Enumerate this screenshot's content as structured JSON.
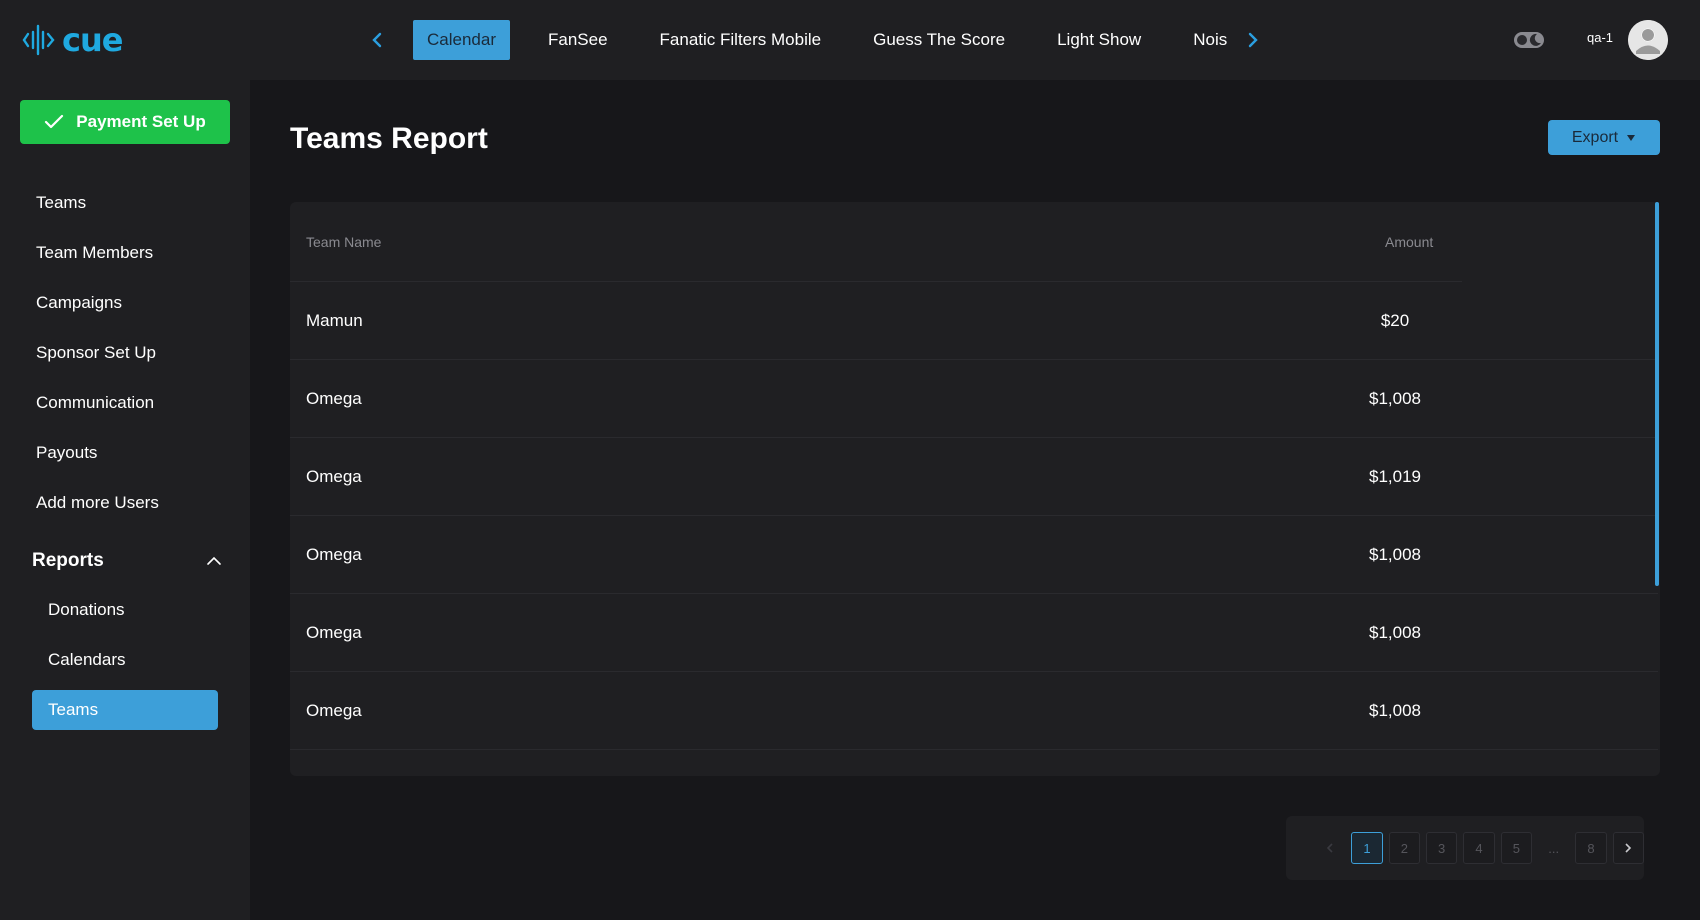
{
  "app": {
    "logo_text": "cue"
  },
  "topnav": {
    "tabs": [
      {
        "label": "Calendar",
        "active": true
      },
      {
        "label": "FanSee",
        "active": false
      },
      {
        "label": "Fanatic Filters Mobile",
        "active": false
      },
      {
        "label": "Guess The Score",
        "active": false
      },
      {
        "label": "Light Show",
        "active": false
      },
      {
        "label": "Noise",
        "active": false
      }
    ],
    "prev_icon": "chevron-left-icon",
    "next_icon": "chevron-right-icon"
  },
  "user": {
    "name": "qa-1",
    "avatar_icon": "user-avatar-icon",
    "theme_icon": "dark-mode-toggle-icon"
  },
  "sidebar": {
    "payment_button": "Payment Set Up",
    "items": [
      {
        "label": "Teams"
      },
      {
        "label": "Team Members"
      },
      {
        "label": "Campaigns"
      },
      {
        "label": "Sponsor Set Up"
      },
      {
        "label": "Communication"
      },
      {
        "label": "Payouts"
      },
      {
        "label": "Add more Users"
      }
    ],
    "reports": {
      "label": "Reports",
      "expanded": true,
      "items": [
        {
          "label": "Donations",
          "active": false
        },
        {
          "label": "Calendars",
          "active": false
        },
        {
          "label": "Teams",
          "active": true
        }
      ]
    }
  },
  "main": {
    "title": "Teams Report",
    "export_label": "Export",
    "table": {
      "columns": [
        "Team Name",
        "Amount"
      ],
      "rows": [
        {
          "name": "Mamun",
          "amount": "$20"
        },
        {
          "name": "Omega",
          "amount": "$1,008"
        },
        {
          "name": "Omega",
          "amount": "$1,019"
        },
        {
          "name": "Omega",
          "amount": "$1,008"
        },
        {
          "name": "Omega",
          "amount": "$1,008"
        },
        {
          "name": "Omega",
          "amount": "$1,008"
        }
      ]
    },
    "pagination": {
      "current": "1",
      "pages": [
        "1",
        "2",
        "3",
        "4",
        "5"
      ],
      "ellipsis": "...",
      "last": "8"
    }
  },
  "colors": {
    "accent": "#3d9fd9",
    "success": "#1ec24a",
    "background": "#17171a",
    "panel": "#1f1f22"
  }
}
